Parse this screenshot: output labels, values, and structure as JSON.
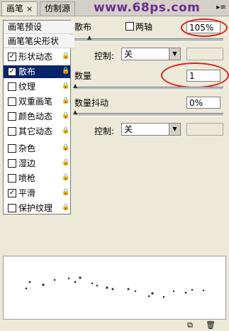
{
  "tabs": [
    {
      "label": "画笔",
      "active": true,
      "close": "×"
    },
    {
      "label": "仿制源",
      "active": false
    }
  ],
  "watermark": "www.68ps.com",
  "panel_menu_icon": "menu-arrow-icon",
  "left_list": {
    "items": [
      {
        "label": "画笔预设",
        "section": true
      },
      {
        "label": "画笔笔尖形状",
        "section": true
      },
      {
        "label": "形状动态",
        "checked": true,
        "lock": true
      },
      {
        "label": "散布",
        "checked": true,
        "lock": true,
        "selected": true
      },
      {
        "label": "纹理",
        "checked": false,
        "lock": true
      },
      {
        "label": "双重画笔",
        "checked": false,
        "lock": true
      },
      {
        "label": "颜色动态",
        "checked": false,
        "lock": true
      },
      {
        "label": "其它动态",
        "checked": false,
        "lock": true
      },
      {
        "label": "杂色",
        "checked": false,
        "lock": true
      },
      {
        "label": "湿边",
        "checked": false,
        "lock": true
      },
      {
        "label": "喷枪",
        "checked": false,
        "lock": true
      },
      {
        "label": "平滑",
        "checked": true,
        "lock": true
      },
      {
        "label": "保护纹理",
        "checked": false,
        "lock": true
      }
    ]
  },
  "scatter": {
    "label": "散布",
    "both_axes_label": "两轴",
    "both_axes_checked": false,
    "value": "105%",
    "slider_level_pct": 5,
    "control_label": "控制:",
    "control_value": "关"
  },
  "count": {
    "label": "数量",
    "value": "1",
    "slider_level_pct": 0
  },
  "count_jitter": {
    "label": "数量抖动",
    "value": "0%",
    "slider_level_pct": 0,
    "control_label": "控制:",
    "control_value": "关"
  },
  "bottom_icons": [
    "new-brush-icon",
    "trash-icon"
  ]
}
